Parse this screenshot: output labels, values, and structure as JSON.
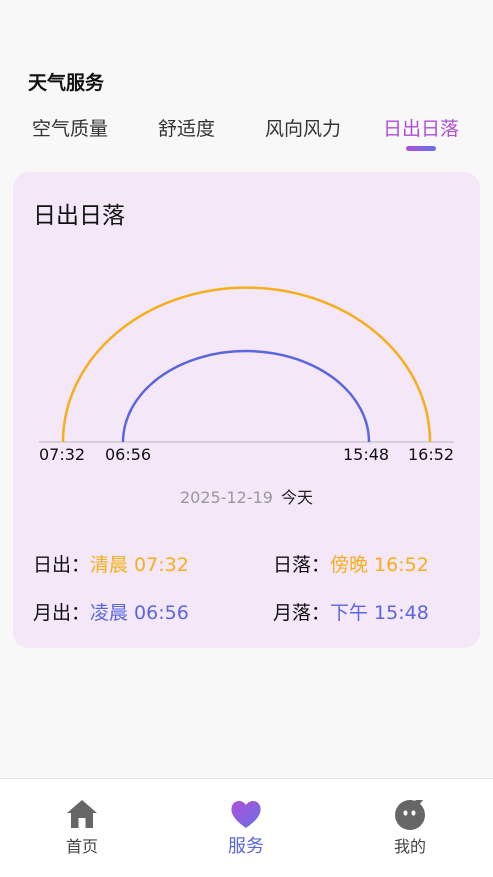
{
  "section": {
    "title": "天气服务"
  },
  "tabs": [
    {
      "label": "空气质量",
      "active": false
    },
    {
      "label": "舒适度",
      "active": false
    },
    {
      "label": "风向风力",
      "active": false
    },
    {
      "label": "日出日落",
      "active": true
    }
  ],
  "card": {
    "title": "日出日落",
    "sun_rise_time": "07:32",
    "moon_rise_time": "06:56",
    "moon_set_time": "15:48",
    "sun_set_time": "16:52",
    "date": "2025-12-19",
    "today": "今天",
    "sunrise_label": "日出：",
    "sunrise_value": "清晨 07:32",
    "sunset_label": "日落：",
    "sunset_value": "傍晚 16:52",
    "moonrise_label": "月出：",
    "moonrise_value": "凌晨 06:56",
    "moonset_label": "月落：",
    "moonset_value": "下午 15:48",
    "sun_color": "#f6ae1c",
    "moon_color": "#5a66e0"
  },
  "bottom_nav": {
    "items": [
      {
        "label": "首页",
        "icon": "home-icon",
        "active": false
      },
      {
        "label": "服务",
        "icon": "heart-icon",
        "active": true
      },
      {
        "label": "我的",
        "icon": "profile-face-icon",
        "active": false
      }
    ]
  }
}
